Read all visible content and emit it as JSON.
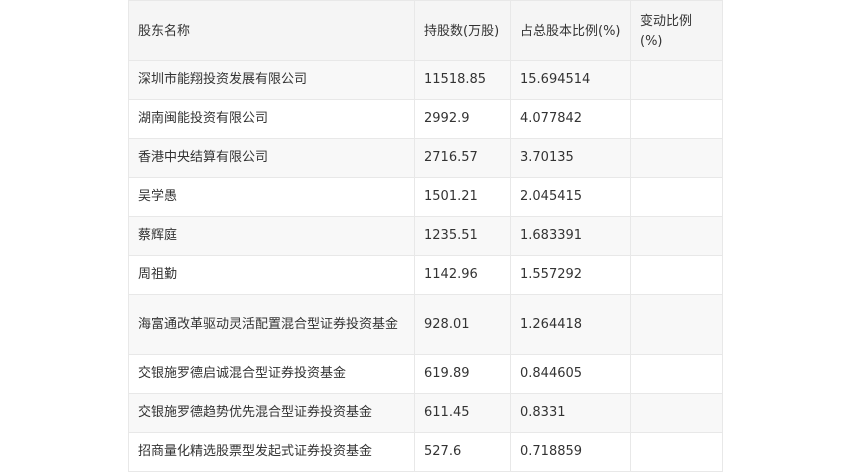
{
  "table": {
    "headers": {
      "name": "股东名称",
      "shares": "持股数(万股)",
      "ratio": "占总股本比例(%)",
      "change": "变动比例(%)"
    },
    "rows": [
      {
        "name": "深圳市能翔投资发展有限公司",
        "shares": "11518.85",
        "ratio": "15.694514",
        "change": ""
      },
      {
        "name": "湖南闽能投资有限公司",
        "shares": "2992.9",
        "ratio": "4.077842",
        "change": ""
      },
      {
        "name": "香港中央结算有限公司",
        "shares": "2716.57",
        "ratio": "3.70135",
        "change": ""
      },
      {
        "name": "吴学愚",
        "shares": "1501.21",
        "ratio": "2.045415",
        "change": ""
      },
      {
        "name": "蔡辉庭",
        "shares": "1235.51",
        "ratio": "1.683391",
        "change": ""
      },
      {
        "name": "周祖勤",
        "shares": "1142.96",
        "ratio": "1.557292",
        "change": ""
      },
      {
        "name": "海富通改革驱动灵活配置混合型证券投资基金",
        "shares": "928.01",
        "ratio": "1.264418",
        "change": ""
      },
      {
        "name": "交银施罗德启诚混合型证券投资基金",
        "shares": "619.89",
        "ratio": "0.844605",
        "change": ""
      },
      {
        "name": "交银施罗德趋势优先混合型证券投资基金",
        "shares": "611.45",
        "ratio": "0.8331",
        "change": ""
      },
      {
        "name": "招商量化精选股票型发起式证券投资基金",
        "shares": "527.6",
        "ratio": "0.718859",
        "change": ""
      }
    ]
  }
}
